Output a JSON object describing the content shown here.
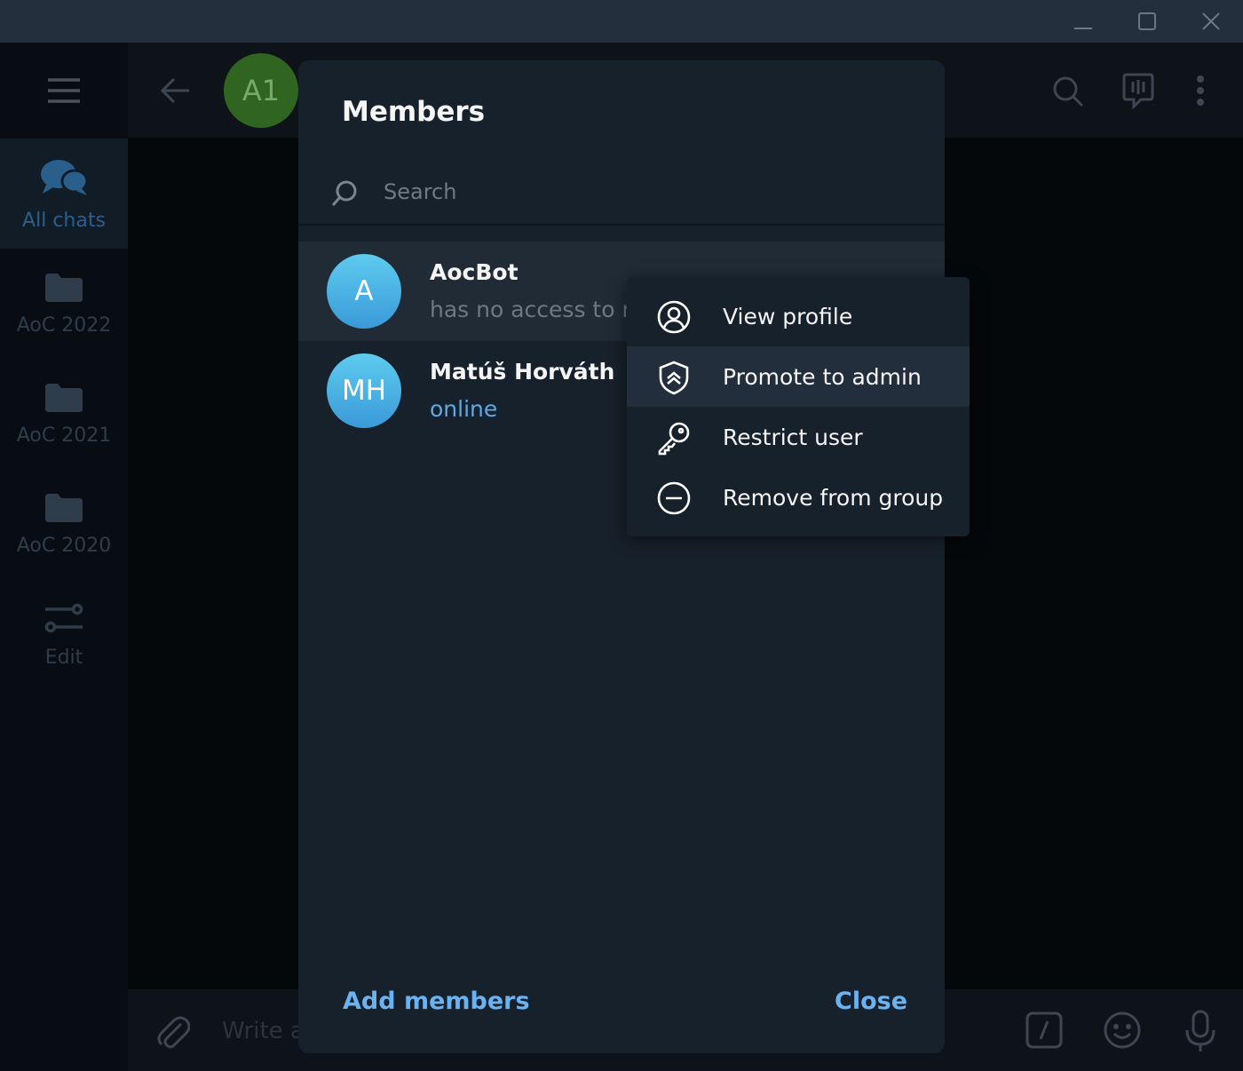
{
  "rail": {
    "folders": [
      {
        "label": "All chats",
        "icon": "chats-icon",
        "active": true
      },
      {
        "label": "AoC 2022",
        "icon": "folder-icon"
      },
      {
        "label": "AoC 2021",
        "icon": "folder-icon"
      },
      {
        "label": "AoC 2020",
        "icon": "folder-icon"
      },
      {
        "label": "Edit",
        "icon": "sliders-icon"
      }
    ]
  },
  "chat": {
    "avatar_initials": "A1",
    "avatar_color": "#2f6520",
    "input_placeholder": "Write a"
  },
  "modal": {
    "title": "Members",
    "search_placeholder": "Search",
    "members": [
      {
        "initials": "A",
        "name": "AocBot",
        "status": "has no access to m",
        "online": false
      },
      {
        "initials": "MH",
        "name": "Matúš Horváth",
        "status": "online",
        "online": true
      }
    ],
    "add_members_label": "Add members",
    "close_label": "Close"
  },
  "context_menu": {
    "items": [
      {
        "label": "View profile",
        "icon": "user-circle-icon"
      },
      {
        "label": "Promote to admin",
        "icon": "shield-icon"
      },
      {
        "label": "Restrict user",
        "icon": "key-icon"
      },
      {
        "label": "Remove from group",
        "icon": "minus-circle-icon"
      }
    ]
  },
  "colors": {
    "accent": "#6ab3f3",
    "online": "#5fa8e3",
    "modal_bg": "#17212b"
  }
}
